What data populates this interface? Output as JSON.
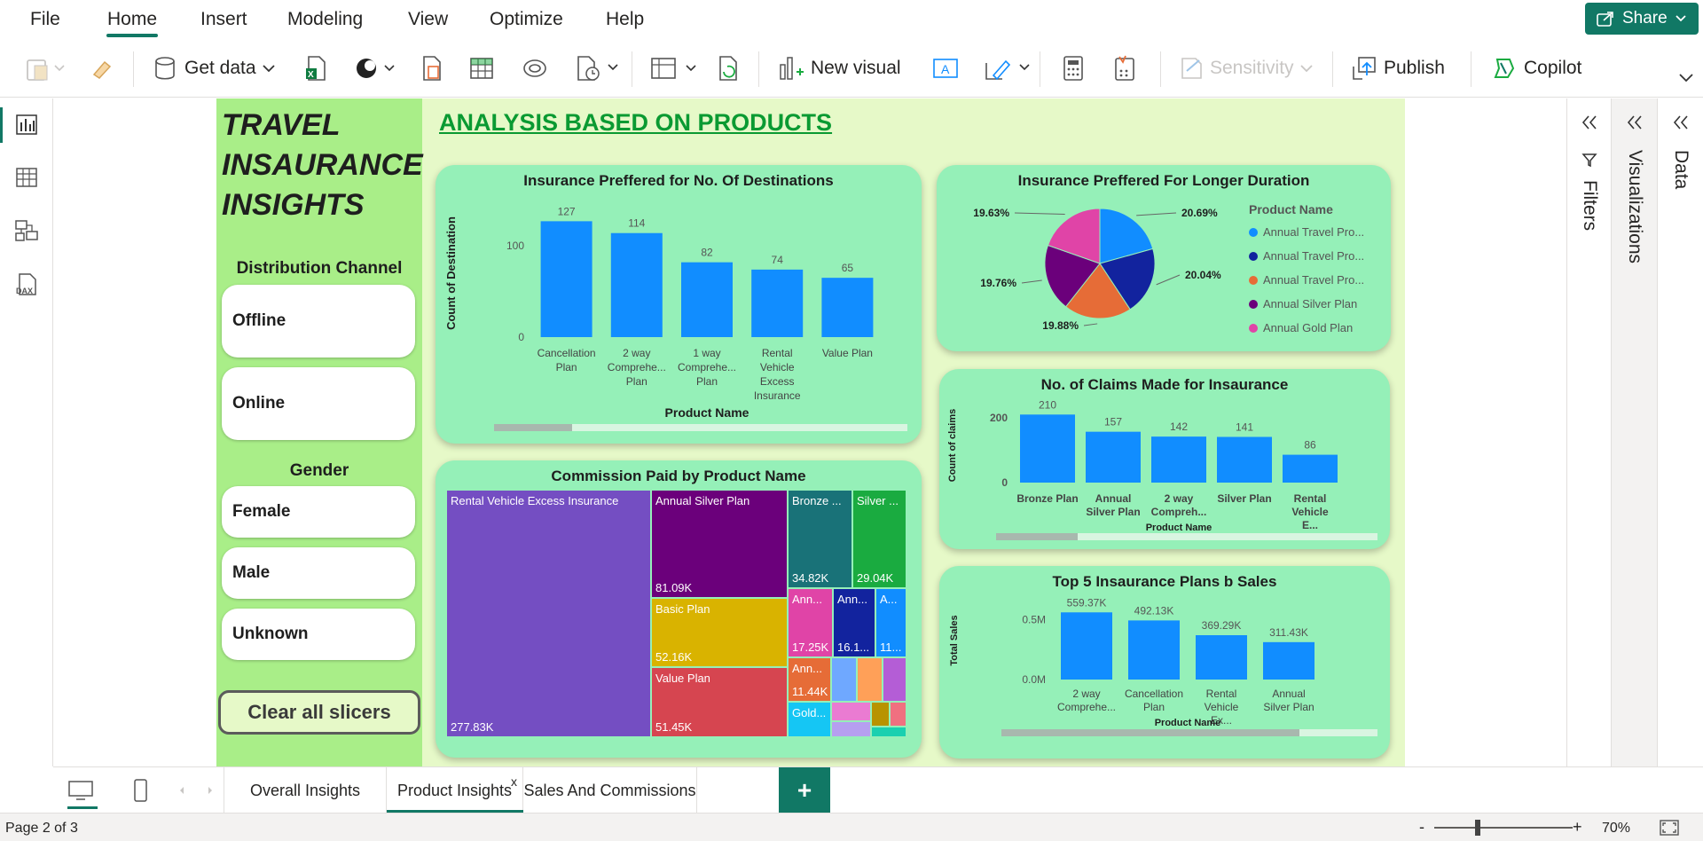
{
  "menu": {
    "file": "File",
    "home": "Home",
    "insert": "Insert",
    "modeling": "Modeling",
    "view": "View",
    "optimize": "Optimize",
    "help": "Help",
    "share": "Share"
  },
  "ribbon": {
    "get_data": "Get data",
    "new_visual": "New visual",
    "sensitivity": "Sensitivity",
    "publish": "Publish",
    "copilot": "Copilot"
  },
  "report": {
    "title": "TRAVEL INSAURANCE INSIGHTS",
    "heading": "ANALYSIS BASED ON PRODUCTS",
    "slicers": {
      "distribution_title": "Distribution Channel",
      "distribution": [
        "Offline",
        "Online"
      ],
      "gender_title": "Gender",
      "gender": [
        "Female",
        "Male",
        "Unknown"
      ],
      "clear": "Clear all slicers"
    }
  },
  "chart_data": [
    {
      "type": "bar",
      "title": "Insurance Preffered for No. Of Destinations",
      "xlabel": "Product Name",
      "ylabel": "Count of Destination",
      "categories": [
        "Cancellation Plan",
        "2 way Comprehe... Plan",
        "1 way Comprehe... Plan",
        "Rental Vehicle Excess Insurance",
        "Value Plan"
      ],
      "values": [
        127,
        114,
        82,
        74,
        65
      ],
      "yticks": [
        "0",
        "100"
      ],
      "ylim": [
        0,
        140
      ]
    },
    {
      "type": "pie",
      "title": "Insurance Preffered For Longer Duration",
      "legend_title": "Product Name",
      "labels": [
        "Annual Travel Pro...",
        "Annual Travel Pro...",
        "Annual Travel Pro...",
        "Annual Silver Plan",
        "Annual Gold Plan"
      ],
      "values": [
        20.69,
        20.04,
        19.88,
        19.76,
        19.63
      ],
      "value_labels": [
        "20.69%",
        "20.04%",
        "19.88%",
        "19.76%",
        "19.63%"
      ],
      "colors": [
        "#118dff",
        "#12239e",
        "#e66c37",
        "#6b007b",
        "#e044a7"
      ]
    },
    {
      "type": "bar",
      "title": "No. of Claims Made for Insaurance",
      "xlabel": "Product Name",
      "ylabel": "Count of claims",
      "categories": [
        "Bronze Plan",
        "Annual Silver Plan",
        "2 way Compreh...",
        "Silver Plan",
        "Rental Vehicle E..."
      ],
      "values": [
        210,
        157,
        142,
        141,
        86
      ],
      "yticks": [
        "0",
        "200"
      ],
      "ylim": [
        0,
        230
      ]
    },
    {
      "type": "treemap",
      "title": "Commission Paid by Product Name",
      "items": [
        {
          "name": "Rental Vehicle Excess Insurance",
          "value": "277.83K",
          "color": "#744ec2"
        },
        {
          "name": "Annual Silver Plan",
          "value": "81.09K",
          "color": "#6b007b"
        },
        {
          "name": "Basic Plan",
          "value": "52.16K",
          "color": "#d9b300"
        },
        {
          "name": "Value Plan",
          "value": "51.45K",
          "color": "#d64550"
        },
        {
          "name": "Bronze ...",
          "value": "34.82K",
          "color": "#197278"
        },
        {
          "name": "Silver ...",
          "value": "29.04K",
          "color": "#1aab40"
        },
        {
          "name": "Ann...",
          "value": "17.25K",
          "color": "#e044a7"
        },
        {
          "name": "Ann...",
          "value": "16.1...",
          "color": "#12239e"
        },
        {
          "name": "A...",
          "value": "11...",
          "color": "#118dff"
        },
        {
          "name": "Ann...",
          "value": "11.44K",
          "color": "#e66c37"
        },
        {
          "name": "Gold...",
          "value": "",
          "color": "#15c6f4"
        }
      ]
    },
    {
      "type": "bar",
      "title": "Top 5 Insaurance Plans b Sales",
      "xlabel": "Product Name",
      "ylabel": "Total Sales",
      "categories": [
        "2 way Comprehe...",
        "Cancellation Plan",
        "Rental Vehicle Ex...",
        "Annual Silver Plan"
      ],
      "values": [
        559.37,
        492.13,
        369.29,
        311.43
      ],
      "value_labels": [
        "559.37K",
        "492.13K",
        "369.29K",
        "311.43K"
      ],
      "yticks": [
        "0.0M",
        "0.5M"
      ],
      "ylim": [
        0,
        650
      ]
    }
  ],
  "panes": {
    "filters": "Filters",
    "visualizations": "Visualizations",
    "data": "Data"
  },
  "tabs": [
    "Overall Insights",
    "Product Insights",
    "Sales And Commissions"
  ],
  "tab_close": "x",
  "add_tab": "+",
  "status": {
    "page": "Page 2 of 3",
    "zoom": "70%",
    "minus": "-",
    "plus": "+"
  }
}
